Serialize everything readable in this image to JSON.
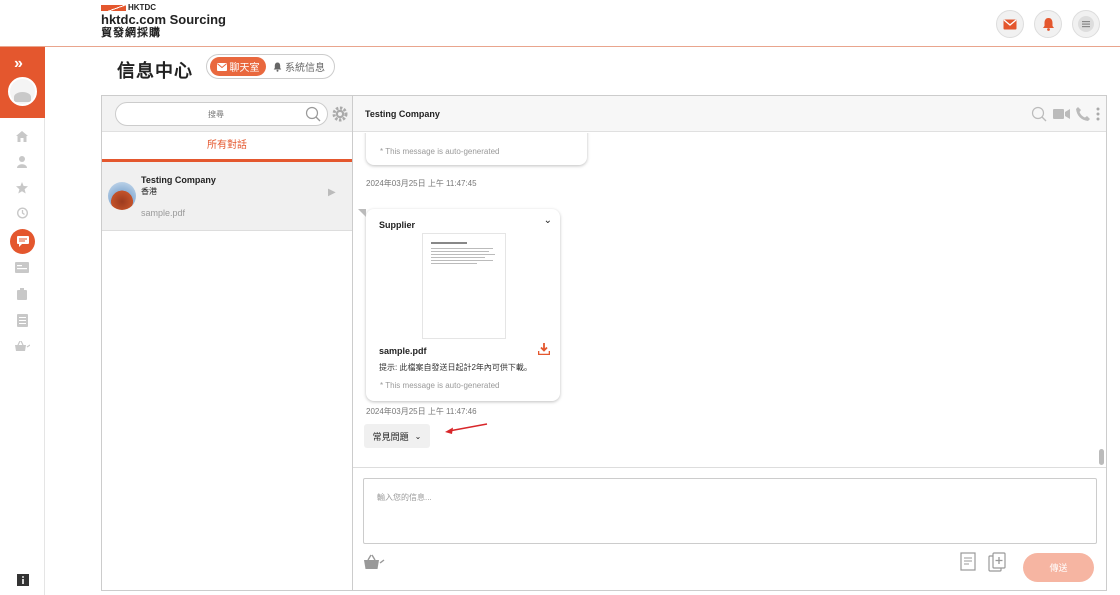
{
  "header": {
    "logo_small": "HKTDC",
    "logo_main": "hktdc.com Sourcing",
    "logo_sub": "貿發網採購",
    "icons": [
      "envelope-icon",
      "bell-icon",
      "menu-icon"
    ],
    "accent": "#e4572e"
  },
  "sidebar": {
    "icons": [
      "double-chevron-right-icon",
      "avatar",
      "home-icon",
      "user-icon",
      "star-icon",
      "history-icon",
      "chat-icon",
      "card-icon",
      "briefcase-icon",
      "list-icon",
      "cart-icon",
      "info-icon"
    ]
  },
  "page": {
    "title": "信息中心",
    "tabs": [
      {
        "label": "聊天室",
        "active": true
      },
      {
        "label": "系統信息",
        "active": false
      }
    ]
  },
  "conversations": {
    "search_placeholder": "搜尋",
    "filter_tab": "所有對話",
    "items": [
      {
        "name": "Testing Company",
        "location": "香港",
        "last_message": "sample.pdf"
      }
    ]
  },
  "chat": {
    "contact_name": "Testing Company",
    "messages": [
      {
        "auto_note": "* This message is auto-generated",
        "timestamp": "2024年03月25日 上午 11:47:45"
      },
      {
        "sender": "Supplier",
        "file_name": "sample.pdf",
        "hint": "提示: 此檔案自發送日起計2年內可供下載。",
        "auto_note": "* This message is auto-generated",
        "timestamp": "2024年03月25日 上午 11:47:46"
      }
    ],
    "faq_label": "常見問題",
    "input_placeholder": "輸入您的信息...",
    "send_label": "傳送",
    "send_color": "#f6b5a2"
  }
}
